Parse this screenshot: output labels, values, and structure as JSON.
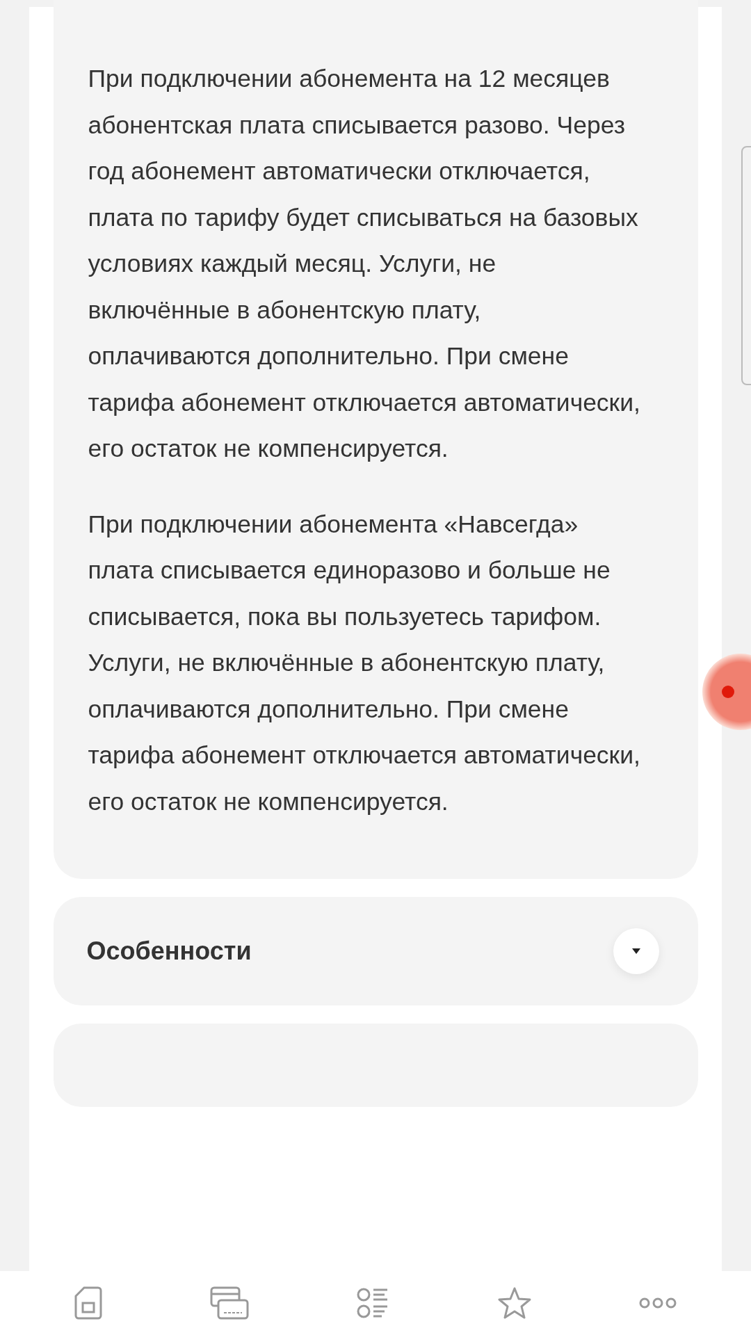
{
  "info_card": {
    "paragraphs": [
      "При подключении абонемента на 12 месяцев абонентская плата списывается разово. Через год абонемент автоматически отключается, плата по тарифу будет списываться на базовых условиях каждый месяц. Услуги, не включённые в абонентскую плату, оплачиваются дополнительно. При смене тарифа абонемент отключается автоматически, его остаток не компенсируется.",
      "При подключении абонемента «Навсегда» плата списывается единоразово и больше не списывается, пока вы пользуетесь тарифом. Услуги, не включённые в абонентскую плату, оплачиваются дополнительно. При смене тарифа абонемент отключается автоматически, его остаток не компенсируется."
    ]
  },
  "accordions": [
    {
      "title": "Особенности",
      "expanded": false
    }
  ],
  "bottom_nav": [
    {
      "kind": "sim"
    },
    {
      "kind": "cards"
    },
    {
      "kind": "list"
    },
    {
      "kind": "star"
    },
    {
      "kind": "more"
    }
  ]
}
